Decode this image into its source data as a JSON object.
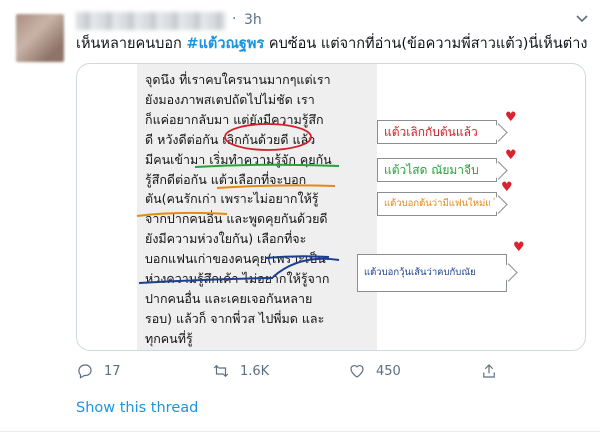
{
  "tweet": {
    "time": "3h",
    "dot": "·",
    "text_prefix": "เห็นหลายคนบอก ",
    "hashtag": "#แต้วณฐพร",
    "text_suffix": " คบซ้อน แต่จากที่อ่าน(ข้อความพี่สาวแต้ว)นี่เห็นต่าง"
  },
  "media": {
    "note_lines": [
      "จุดนึง ที่เราคบใครนานมากๆแต่เรา",
      "ยังมองภาพสเตปถัดไปไม่ชัด เรา",
      "ก็แค่อยากลับมา แต่ยังมีความรู้สึก",
      "ดี หวังดีต่อกัน  เลิกกันด้วยดี แล้ว",
      "มีคนเข้ามา เริ่มทำความรู้จัก คุยกัน",
      "รู้สึกดีต่อกัน  แต้วเลือกที่จะบอก",
      "ตัน(คนรักเก่า  เพราะไม่อยากให้รู้",
      "จากปากคนอื่น และพูดคุยกันด้วยดี",
      "ยังมีความห่วงใยกัน)  เลือกที่จะ",
      "บอกแฟนเก่าของคนคุย(เพราะเป็น",
      "ห่วงความรู้สึกเค้า ไม่อยากให้รู้จาก",
      "ปากคนอื่น และเคยเจอกันหลาย",
      "รอบ) แล้วก็ จากพี่วส ไปพี่มด และ",
      "ทุกคนที่รู้"
    ],
    "callouts": [
      {
        "text": "แต้วเลิกกับต้นแล้ว",
        "color": "#d0202a"
      },
      {
        "text": "แต้วไสด ณัยมาจีบ",
        "color": "#27a33a"
      },
      {
        "text": "แต้วบอกต้นว่ามีแฟนใหม่แล้ว",
        "color": "#e38a12"
      },
      {
        "text": "แต้วบอกวุ้นเส้นว่าคบกับณัย",
        "color": "#1e3f8f"
      }
    ],
    "heart_glyph": "♥"
  },
  "actions": {
    "replies": "17",
    "retweets": "1.6K",
    "likes": "450"
  },
  "show_thread": "Show this thread",
  "colors": {
    "link": "#1b95e0",
    "muted": "#5b7083",
    "annot_red": "#d0202a",
    "annot_green": "#27a33a",
    "annot_orange": "#e38a12",
    "annot_blue": "#1e3f8f"
  }
}
